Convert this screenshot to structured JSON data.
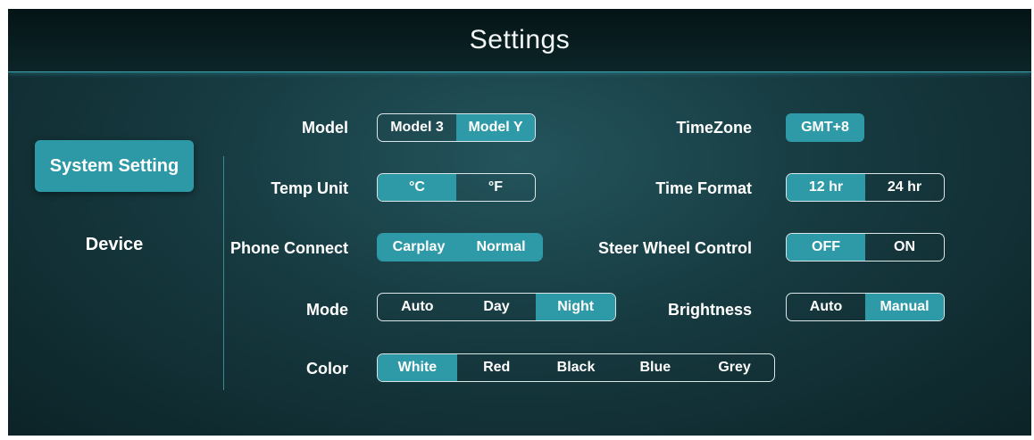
{
  "header": {
    "title": "Settings"
  },
  "sidebar": {
    "items": [
      {
        "label": "System Setting",
        "active": true
      },
      {
        "label": "Device",
        "active": false
      }
    ]
  },
  "settings": {
    "model": {
      "label": "Model",
      "options": [
        "Model 3",
        "Model Y"
      ],
      "selected": "Model Y"
    },
    "temp_unit": {
      "label": "Temp Unit",
      "options": [
        "°C",
        "°F"
      ],
      "selected": "°C"
    },
    "phone_connect": {
      "label": "Phone Connect",
      "options": [
        "Carplay",
        "Normal"
      ],
      "selected": "Carplay"
    },
    "mode": {
      "label": "Mode",
      "options": [
        "Auto",
        "Day",
        "Night"
      ],
      "selected": "Night"
    },
    "color": {
      "label": "Color",
      "options": [
        "White",
        "Red",
        "Black",
        "Blue",
        "Grey"
      ],
      "selected": "White"
    },
    "timezone": {
      "label": "TimeZone",
      "value": "GMT+8"
    },
    "time_format": {
      "label": "Time Format",
      "options": [
        "12 hr",
        "24 hr"
      ],
      "selected": "12 hr"
    },
    "steer_wheel_control": {
      "label": "Steer Wheel Control",
      "options": [
        "OFF",
        "ON"
      ],
      "selected": "OFF"
    },
    "brightness": {
      "label": "Brightness",
      "options": [
        "Auto",
        "Manual"
      ],
      "selected": "Manual"
    }
  },
  "colors": {
    "accent": "#2f9aa7",
    "background": "#163a40",
    "header": "#071a1c"
  }
}
